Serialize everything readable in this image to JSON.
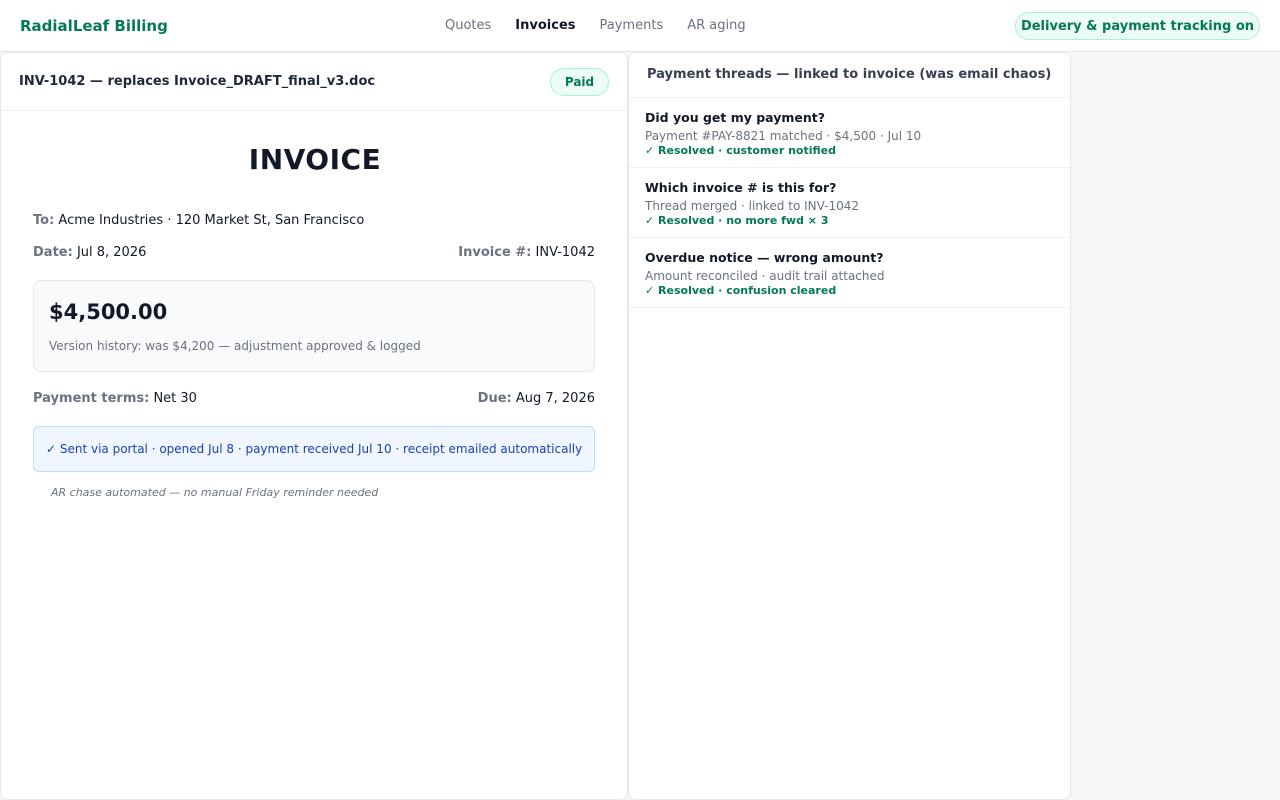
{
  "topbar": {
    "brand": "RadialLeaf Billing",
    "nav": [
      "Quotes",
      "Invoices",
      "Payments",
      "AR aging"
    ],
    "active_nav": "Invoices",
    "tracking_label": "Delivery & payment tracking on"
  },
  "invoice": {
    "file_title": "INV-1042 — replaces Invoice_DRAFT_final_v3.doc",
    "status_badge": "Paid",
    "doc_title": "INVOICE",
    "to_label": "To:",
    "to_value": "Acme Industries · 120 Market St, San Francisco",
    "date_label": "Date:",
    "date_value": "Jul 8, 2026",
    "number_label": "Invoice #:",
    "number_value": "INV-1042",
    "amount": "$4,500.00",
    "version_history": "Version history: was $4,200 — adjustment approved & logged",
    "terms_label": "Payment terms:",
    "terms_value": "Net 30",
    "due_label": "Due:",
    "due_value": "Aug 7, 2026",
    "delivery_status": "✓ Sent via portal · opened Jul 8 · payment received Jul 10 · receipt emailed automatically",
    "ar_note": "AR chase automated — no manual Friday reminder needed"
  },
  "threads": {
    "header": "Payment threads — linked to invoice (was email chaos)",
    "items": [
      {
        "title": "Did you get my payment?",
        "detail": "Payment #PAY-8821 matched · $4,500 · Jul 10",
        "status": "✓ Resolved · customer notified"
      },
      {
        "title": "Which invoice # is this for?",
        "detail": "Thread merged · linked to INV-1042",
        "status": "✓ Resolved · no more fwd × 3"
      },
      {
        "title": "Overdue notice — wrong amount?",
        "detail": "Amount reconciled · audit trail attached",
        "status": "✓ Resolved · confusion cleared"
      }
    ]
  },
  "colors": {
    "brand": "#047857",
    "success_bg": "#ecfdf5",
    "info_bg": "#eff6ff",
    "info_text": "#1e40af"
  }
}
